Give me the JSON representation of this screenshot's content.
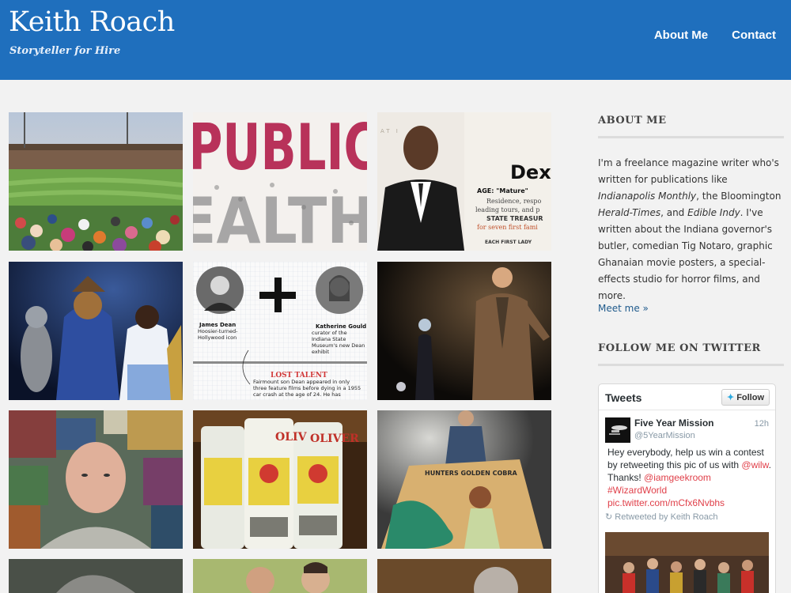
{
  "header": {
    "site_title": "Keith Roach",
    "tagline": "Storyteller for Hire",
    "nav": [
      {
        "label": "About Me"
      },
      {
        "label": "Contact"
      }
    ]
  },
  "portfolio": {
    "tiles": [
      {
        "subject": "baseball-stadium-crowd"
      },
      {
        "subject": "public-health-typography",
        "visible_text": "PUBLIC HEALTH"
      },
      {
        "subject": "governor-butler-portrait",
        "visible_text": [
          "Dext",
          "AGE: \"Mature\"",
          "Residence, respo",
          "leading tours, and p",
          "STATE TREASUR",
          "for seven first fami",
          "EACH FIRST LADY",
          "AT I"
        ]
      },
      {
        "subject": "wizard-of-oz-stage"
      },
      {
        "subject": "james-dean-infographic",
        "visible_text": {
          "left_name": "James Dean",
          "left_caption": "Hoosier-turned-Hollywood icon",
          "right_name": "Katherine Gould",
          "right_caption": "curator of the Indiana State Museum's new Dean exhibit",
          "heading": "LOST TALENT",
          "body": "Fairmount son Dean appeared in only three feature films before dying in a 1955 car crash at the age of 24. He has"
        }
      },
      {
        "subject": "theater-performer-spotlight"
      },
      {
        "subject": "bald-man-portrait"
      },
      {
        "subject": "oliver-beer-cans",
        "visible_text": "OLIVER"
      },
      {
        "subject": "ghanaian-movie-poster",
        "visible_text": "HUNTERS GOLDEN COBRA"
      },
      {
        "subject": "partial-photo-1"
      },
      {
        "subject": "partial-photo-2"
      },
      {
        "subject": "partial-photo-3"
      }
    ]
  },
  "sidebar": {
    "about": {
      "heading": "ABOUT ME",
      "text_1": "I'm a freelance magazine writer who's written for publications like ",
      "pub_1": "Indianapolis Monthly",
      "text_2": ", the Bloomington ",
      "pub_2": "Herald-Times",
      "text_3": ", and ",
      "pub_3": "Edible Indy",
      "text_4": ". I've written about the Indiana governor's butler, comedian Tig Notaro, graphic Ghanaian movie posters, a special-effects studio for horror films, and more.",
      "link": "Meet me »"
    },
    "twitter": {
      "heading": "FOLLOW ME ON TWITTER",
      "widget_title": "Tweets",
      "follow_label": "Follow",
      "tweet": {
        "name": "Five Year Mission",
        "handle": "@5YearMission",
        "time": "12h",
        "text_1": "Hey everybody, help us win a contest by retweeting this pic of us with ",
        "mention_1": "@wilw",
        "text_2": ". Thanks! ",
        "mention_2": "@iamgeekroom",
        "hashtag": "#WizardWorld",
        "pic_link": "pic.twitter.com/mCfx6Nvbhs",
        "retweeted_by": "Retweeted by Keith Roach"
      }
    }
  },
  "colors": {
    "header_bg": "#1f6fbd",
    "page_bg": "#f2f2f2",
    "link": "#1f5a8c",
    "tweet_link": "#e0404a"
  }
}
